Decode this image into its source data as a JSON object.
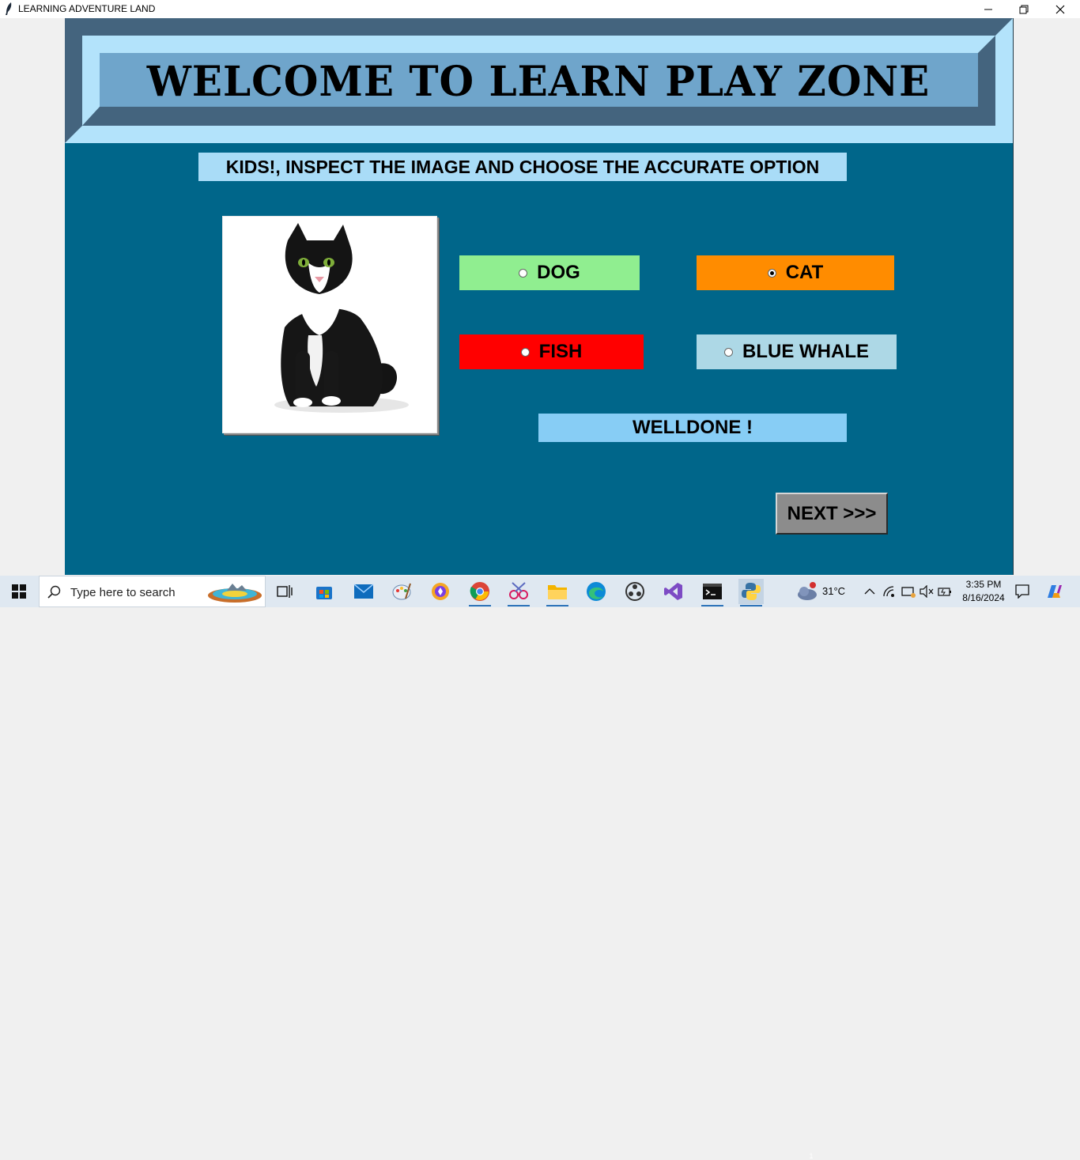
{
  "window": {
    "title": "LEARNING ADVENTURE LAND"
  },
  "banner": {
    "title": "WELCOME TO LEARN PLAY ZONE"
  },
  "quiz": {
    "instruction": "KIDS!, INSPECT THE IMAGE AND CHOOSE THE ACCURATE OPTION",
    "image_subject": "black-and-white cat",
    "options": [
      {
        "label": "DOG",
        "color": "#90ee90",
        "selected": false
      },
      {
        "label": "CAT",
        "color": "#ff8c00",
        "selected": true
      },
      {
        "label": "FISH",
        "color": "#ff0000",
        "selected": false
      },
      {
        "label": "BLUE WHALE",
        "color": "#add8e6",
        "selected": false
      }
    ],
    "feedback": "WELLDONE !",
    "next_label": "NEXT >>>"
  },
  "colors": {
    "canvas": "#00668a",
    "banner_dark": "#44647e",
    "banner_light": "#b3e3fb",
    "banner_inner": "#6fa5cb"
  },
  "taskbar": {
    "search_placeholder": "Type here to search",
    "weather": "31°C",
    "weather_badge": "1",
    "time": "3:35 PM",
    "date": "8/16/2024"
  }
}
